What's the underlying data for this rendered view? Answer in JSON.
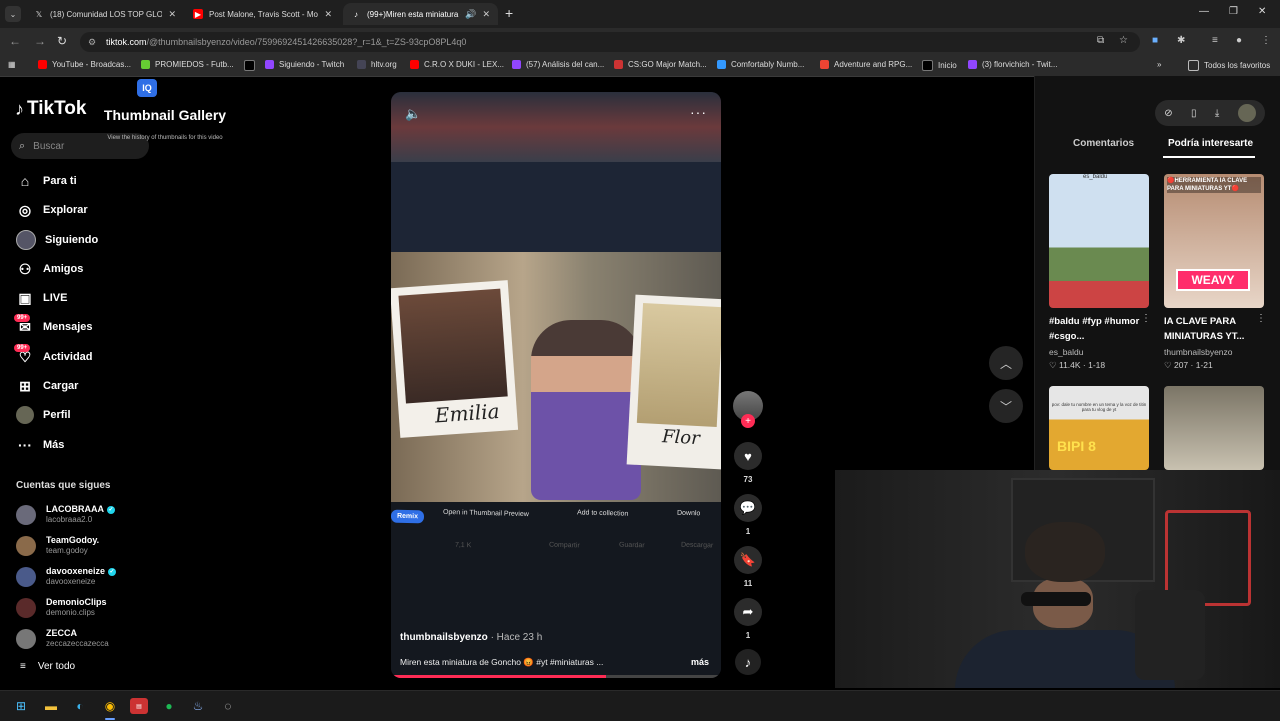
{
  "tabs": [
    {
      "title": "(18) Comunidad LOS TOP GLOB",
      "icon": "x-icon",
      "active": false
    },
    {
      "title": "Post Malone, Travis Scott - Moc",
      "icon": "youtube-icon",
      "active": false
    },
    {
      "title": "(99+)Miren esta miniatura d",
      "icon": "tiktok-icon",
      "active": true
    }
  ],
  "address": {
    "domain": "tiktok.com",
    "path": "/@thumbnailsbyenzo/video/7599692451426635028?_r=1&_t=ZS-93cpO8PL4q0"
  },
  "bookmarks": [
    "YouTube - Broadcas...",
    "PROMIEDOS - Futb...",
    "",
    "Siguiendo - Twitch",
    "hltv.org",
    "C.R.O X DUKI - LEX...",
    "(57) Análisis del can...",
    "CS:GO Major Match...",
    "Comfortably Numb...",
    "Adventure and RPG...",
    "Inicio",
    "(3) florvichich - Twit..."
  ],
  "bookmarks_all": "Todos los favoritos",
  "sidebar": {
    "logo": "TikTok",
    "search_placeholder": "Buscar",
    "nav": [
      {
        "label": "Para ti",
        "icon": "home-icon",
        "badge": ""
      },
      {
        "label": "Explorar",
        "icon": "compass-icon",
        "badge": ""
      },
      {
        "label": "Siguiendo",
        "icon": "avatar-icon",
        "badge": ""
      },
      {
        "label": "Amigos",
        "icon": "friends-icon",
        "badge": ""
      },
      {
        "label": "LIVE",
        "icon": "live-icon",
        "badge": ""
      },
      {
        "label": "Mensajes",
        "icon": "messages-icon",
        "badge": "99+"
      },
      {
        "label": "Actividad",
        "icon": "activity-icon",
        "badge": "99+"
      },
      {
        "label": "Cargar",
        "icon": "upload-icon",
        "badge": ""
      },
      {
        "label": "Perfil",
        "icon": "profile-icon",
        "badge": ""
      },
      {
        "label": "Más",
        "icon": "more-icon",
        "badge": ""
      }
    ],
    "following_title": "Cuentas que sigues",
    "following": [
      {
        "name": "LACOBRAAA",
        "handle": "lacobraaa2.0",
        "verified": true
      },
      {
        "name": "TeamGodoy.",
        "handle": "team.godoy",
        "verified": false
      },
      {
        "name": "davooxeneize",
        "handle": "davooxeneize",
        "verified": true
      },
      {
        "name": "DemonioClips",
        "handle": "demonio.clips",
        "verified": false
      },
      {
        "name": "ZECCA",
        "handle": "zeccazeccazecca",
        "verified": false
      }
    ],
    "see_all": "Ver todo"
  },
  "video": {
    "gallery_logo": "IQ",
    "gallery_title": "Thumbnail Gallery",
    "gallery_sub": "View the history of thumbnails for this video",
    "caption_left": "Emilia",
    "caption_right": "Flor",
    "actions": [
      "Remix",
      "Open in Thumbnail Preview",
      "Add to collection",
      "Downlo"
    ],
    "faint_actions": [
      "7,1 K",
      "Compartir",
      "Guardar",
      "Descargar"
    ],
    "author": "thumbnailsbyenzo",
    "time": "· Hace 23 h",
    "caption": "Miren esta miniatura de Goncho 😡 #yt #miniaturas ...",
    "more": "más",
    "progress": 0.65
  },
  "actions": {
    "likes": "73",
    "comments": "1",
    "saves": "11",
    "shares": "1"
  },
  "right_panel": {
    "tabs": [
      "Comentarios",
      "Podría interesarte"
    ],
    "active_tab": 1,
    "items": [
      {
        "caption": "#baldu #fyp #humor #csgo...",
        "author": "es_baldu",
        "stats": "♡ 11.4K · 1-18",
        "overlay": "es_baldu"
      },
      {
        "caption": "IA CLAVE PARA MINIATURAS YT...",
        "author": "thumbnailsbyenzo",
        "stats": "♡ 207 · 1-21",
        "overlay": "🔴HERRAMIENTA IA CLAVE PARA MINIATURAS YT🔴",
        "tag": "WEAVY"
      },
      {
        "caption": "",
        "author": "",
        "stats": "",
        "overlay": "pov: dale tu nombre en un tema y la voz de titin para tu vlog de yt",
        "tag": "BIPI 8"
      },
      {
        "caption": "",
        "author": "",
        "stats": "",
        "overlay": ""
      }
    ]
  }
}
